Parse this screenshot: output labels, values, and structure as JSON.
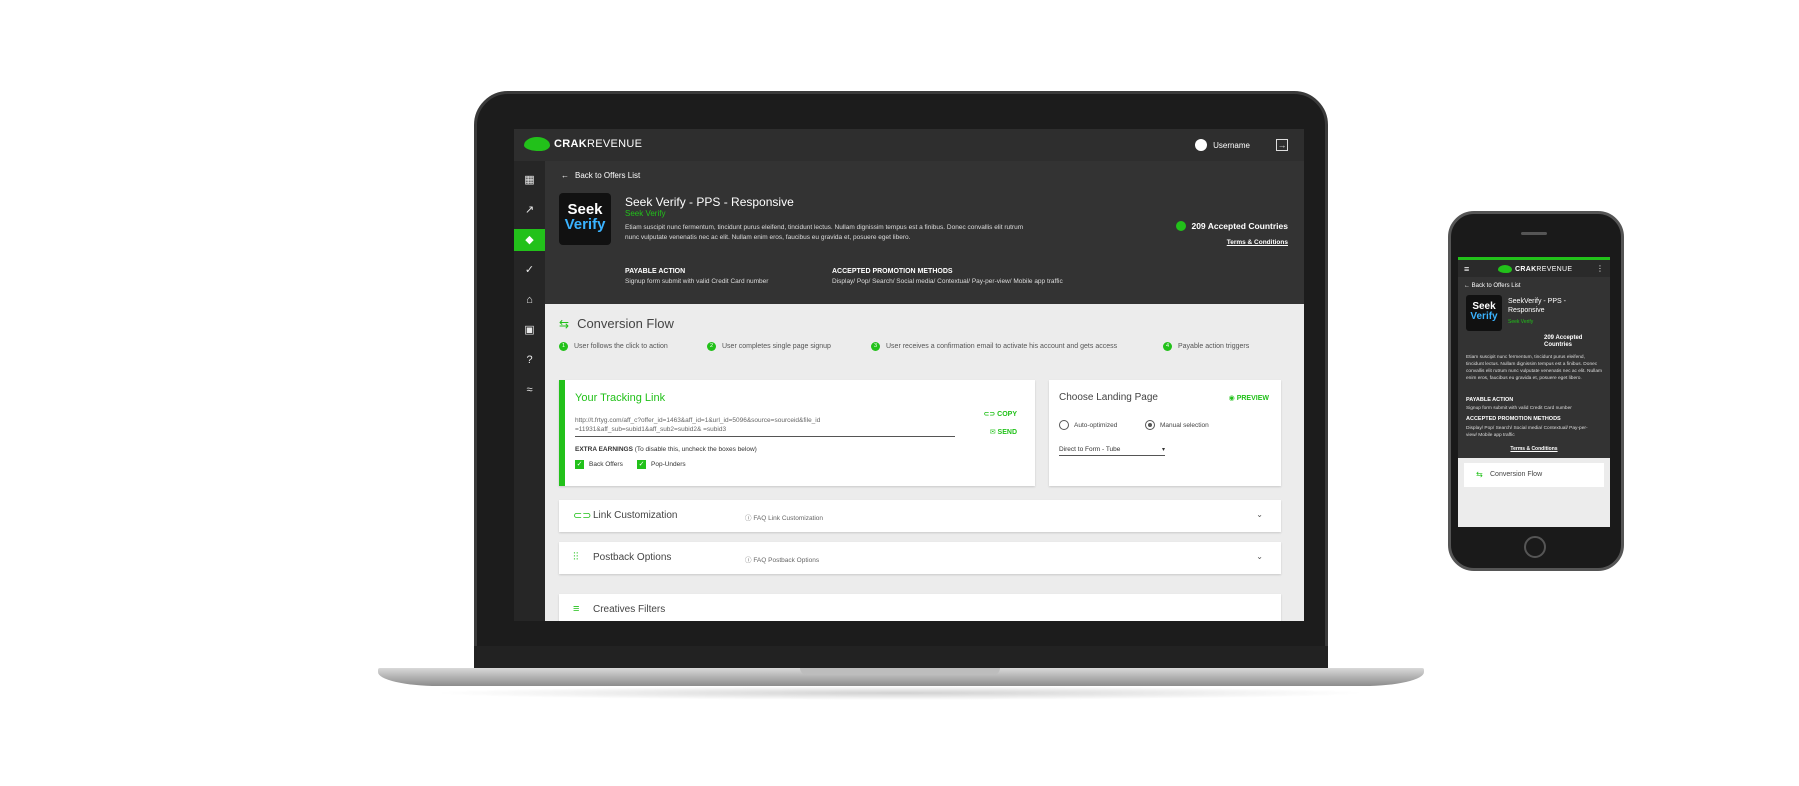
{
  "app": {
    "logo_bold": "CRAK",
    "logo_rest": "REVENUE",
    "username": "Username"
  },
  "sidebar": {
    "icons": [
      "dashboard-icon",
      "stats-icon",
      "offers-icon",
      "check-icon",
      "bank-icon",
      "profile-icon",
      "help-icon",
      "whale-icon"
    ],
    "active_index": 2
  },
  "offer": {
    "back_label": "Back to Offers List",
    "logo_line1": "Seek",
    "logo_line2": "Verify",
    "title": "Seek Verify - PPS - Responsive",
    "subtitle": "Seek Verify",
    "description": "Etiam suscipit nunc fermentum, tincidunt purus eleifend, tincidunt lectus. Nullam dignissim tempus est a finibus. Donec convallis elit rutrum nunc vulputate venenatis nec ac elit. Nullam enim eros, faucibus eu gravida et, posuere eget libero.",
    "countries": "209 Accepted Countries",
    "terms": "Terms & Conditions",
    "payable_heading": "PAYABLE ACTION",
    "payable_value": "Signup form submit with valid Credit Card number",
    "promo_heading": "ACCEPTED PROMOTION METHODS",
    "promo_value": "Display/ Pop/ Search/ Social media/ Contextual/ Pay-per-view/ Mobile app traffic"
  },
  "conversion_flow": {
    "title": "Conversion Flow",
    "steps": [
      {
        "num": "1",
        "label": "User follows the click to action"
      },
      {
        "num": "2",
        "label": "User completes single page signup"
      },
      {
        "num": "3",
        "label": "User receives a confirmation email to activate his account and gets access"
      },
      {
        "num": "4",
        "label": "Payable action triggers"
      }
    ]
  },
  "tracking": {
    "title": "Your Tracking Link",
    "link_line1": "http://t.frtyg.com/aff_c?offer_id=1463&aff_id=1&url_id=5096&source=sourceid&file_id",
    "link_line2": "=11931&aff_sub=subid1&aff_sub2=subid2& =subid3",
    "copy_label": "COPY",
    "send_label": "SEND",
    "extra_heading": "EXTRA EARNINGS",
    "extra_note": "(To disable this, uncheck the boxes below)",
    "checkbox1": "Back Offers",
    "checkbox2": "Pop-Unders"
  },
  "landing": {
    "title": "Choose Landing Page",
    "preview_label": "PREVIEW",
    "option1": "Auto-optimized",
    "option2": "Manual selection",
    "selected_option": "Manual selection",
    "select_value": "Direct to Form - Tube"
  },
  "accordions": [
    {
      "title": "Link Customization",
      "faq": "FAQ Link Customization"
    },
    {
      "title": "Postback Options",
      "faq": "FAQ Postback Options"
    },
    {
      "title": "Creatives Filters",
      "faq": ""
    }
  ],
  "phone": {
    "back_label": "Back to Offers List",
    "title": "SeekVerify - PPS - Responsive",
    "subtitle": "Seek Verify",
    "countries": "209 Accepted Countries",
    "description": "Etiam suscipit nunc fermentum, tincidunt purus eleifend, tincidunt lectus. Nullam dignissim tempus est a finibus. Donec convallis elit rutrum nunc vulputate venenatis nec ac elit. Nullam enim eros, faucibus eu gravida et, posuere eget libero.",
    "payable_heading": "PAYABLE ACTION",
    "payable_value": "Signup form submit with valid Credit Card number",
    "promo_heading": "ACCEPTED PROMOTION METHODS",
    "promo_value": "Display/ Pop/ Search/ Social media/ Contextual/ Pay-per-view/ Mobile app traffic",
    "terms": "Terms & Conditions",
    "cf_title": "Conversion Flow"
  },
  "colors": {
    "accent": "#22c11a",
    "header_bg": "#333333",
    "topbar_bg": "#2e2e2e",
    "content_bg": "#ececec"
  }
}
